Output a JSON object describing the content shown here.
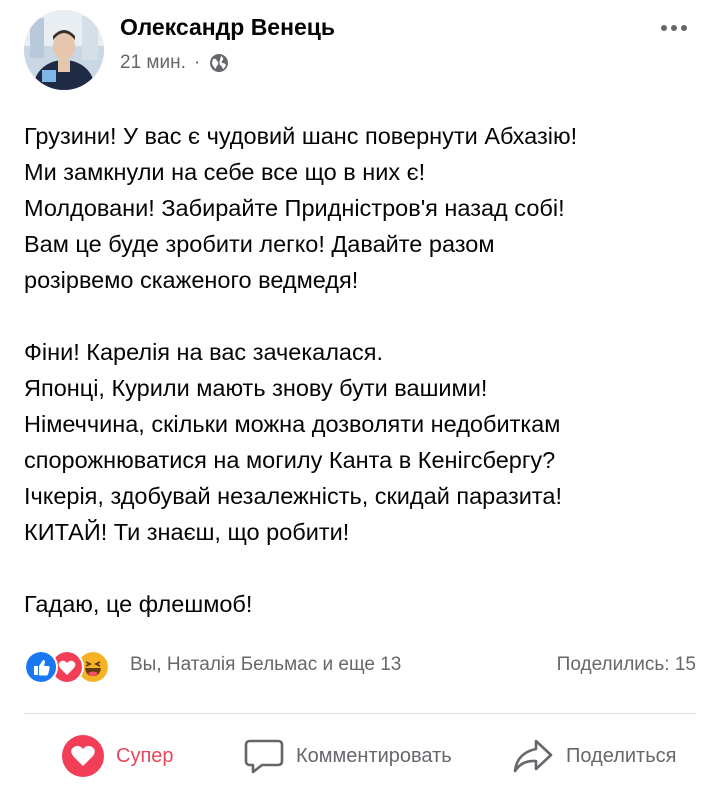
{
  "post": {
    "author": "Олександр Венець",
    "time": "21 мин.",
    "separator": "·",
    "body_paragraphs": [
      [
        "Грузини! У вас є чудовий шанс повернути Абхазію!",
        "Ми замкнули на себе все що в них є!",
        "Молдовани! Забирайте Придністров'я назад собі!",
        "Вам це буде зробити легко! Давайте разом",
        "розірвемо скаженого ведмедя!"
      ],
      [
        "Фіни! Карелія на вас зачекалася.",
        "Японці, Курили мають знову бути вашими!",
        "Німеччина, скільки можна дозволяти недобиткам",
        "спорожнюватися на могилу Канта в Кенігсбергу?",
        "Ічкерія, здобувай незалежність, скидай паразита!",
        "КИТАЙ! Ти знаєш, що робити!"
      ],
      [
        "Гадаю, це флешмоб!"
      ]
    ]
  },
  "stats": {
    "reactions_text": "Вы, Наталія Бельмас и еще 13",
    "shares_text": "Поделились: 15",
    "reaction_icons": [
      "like-icon",
      "love-icon",
      "haha-icon"
    ]
  },
  "actions": {
    "like_label": "Супер",
    "comment_label": "Комментировать",
    "share_label": "Поделиться"
  },
  "colors": {
    "like_blue": "#1877f2",
    "love_red": "#f33e58",
    "haha_yellow": "#f7b125",
    "reacted_red": "#e8465a",
    "secondary_text": "#65676b"
  }
}
